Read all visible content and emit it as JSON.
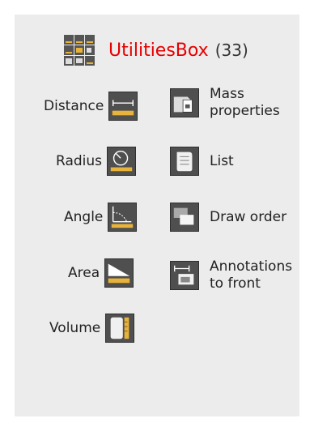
{
  "header": {
    "title": "UtilitiesBox",
    "count": "(33)",
    "logo_icon": "utilities-grid-icon"
  },
  "tools": [
    {
      "key": "distance",
      "label": "Distance",
      "icon": "ruler-distance-icon"
    },
    {
      "key": "mass",
      "label": "Mass\nproperties",
      "icon": "mass-properties-icon"
    },
    {
      "key": "radius",
      "label": "Radius",
      "icon": "radius-icon"
    },
    {
      "key": "list",
      "label": "List",
      "icon": "list-scroll-icon"
    },
    {
      "key": "angle",
      "label": "Angle",
      "icon": "angle-icon"
    },
    {
      "key": "draworder",
      "label": "Draw order",
      "icon": "draw-order-icon"
    },
    {
      "key": "area",
      "label": "Area",
      "icon": "area-icon"
    },
    {
      "key": "annot",
      "label": "Annotations\nto front",
      "icon": "annotations-to-front-icon"
    },
    {
      "key": "volume",
      "label": "Volume",
      "icon": "volume-icon"
    }
  ],
  "colors": {
    "title": "#e60000",
    "panel": "#ececec",
    "icon_bg": "#4f4f4f",
    "ruler": "#e8b33a"
  }
}
